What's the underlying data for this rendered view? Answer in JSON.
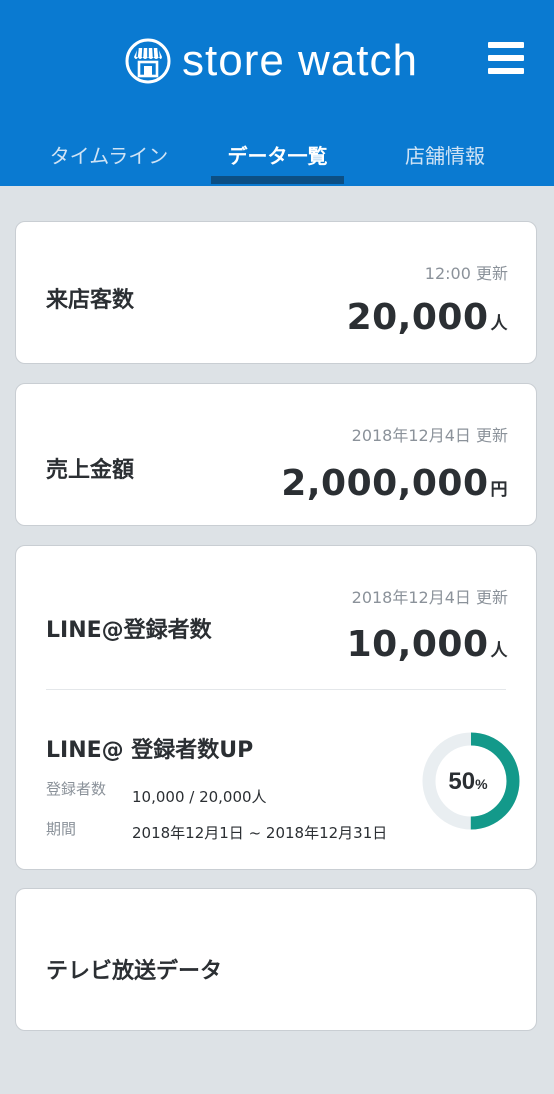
{
  "app": {
    "title": "store watch"
  },
  "header": {
    "menu_icon": "hamburger-menu-icon"
  },
  "tabs": [
    {
      "label": "タイムライン",
      "active": false
    },
    {
      "label": "データ一覧",
      "active": true
    },
    {
      "label": "店舗情報",
      "active": false
    }
  ],
  "cards": {
    "visitors": {
      "title": "来店客数",
      "updated": "12:00 更新",
      "value": "20,000",
      "unit": "人"
    },
    "sales": {
      "title": "売上金額",
      "updated": "2018年12月4日 更新",
      "value": "2,000,000",
      "unit": "円"
    },
    "line": {
      "title": "LINE@登録者数",
      "updated": "2018年12月4日 更新",
      "value": "10,000",
      "unit": "人",
      "campaign": {
        "title": "LINE@ 登録者数UP",
        "count_label": "登録者数",
        "count_value": "10,000 / 20,000人",
        "period_label": "期間",
        "period_value": "2018年12月1日 ~ 2018年12月31日",
        "progress_percent": 50,
        "progress_number": "50",
        "progress_unit": "%",
        "progress_color": "#13998a",
        "track_color": "#e9eef1"
      }
    },
    "tv": {
      "title": "テレビ放送データ"
    }
  },
  "colors": {
    "header": "#0a7ad1",
    "active_tab_indicator": "#0c4f84"
  }
}
